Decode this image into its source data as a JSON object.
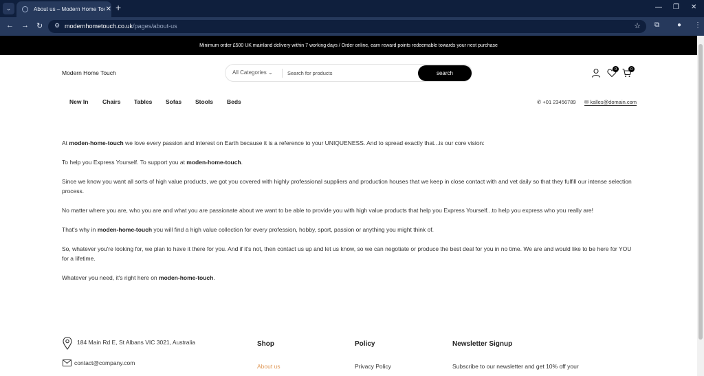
{
  "browser": {
    "tab_title": "About us – Modern Home Touc",
    "url_domain": "modernhometouch.co.uk",
    "url_path": "/pages/about-us"
  },
  "announcement": "Minimum order £500 UK mainland delivery within 7 working days / Order online, earn reward points redeemable towards your next purchase",
  "header": {
    "logo": "Modern Home Touch",
    "category_label": "All Categories",
    "search_placeholder": "Search for products",
    "search_button": "search",
    "wishlist_count": "0",
    "cart_count": "0"
  },
  "nav": {
    "items": [
      "New In",
      "Chairs",
      "Tables",
      "Sofas",
      "Stools",
      "Beds"
    ],
    "phone": "+01 23456789",
    "email": "kalles@domain.com"
  },
  "content": {
    "p1_pre": "At ",
    "brand": "moden-home-touch",
    "p1_post": " we love every passion and interest on Earth because it is a reference to your UNIQUENESS. And to spread exactly that...is our core vision:",
    "p2_pre": "To help you Express Yourself. To support you at ",
    "p2_post": ".",
    "p3": "Since we know you want all sorts of high value products, we got you covered with highly professional suppliers and production houses that we keep in close contact with and vet daily so that they fulfill our intense selection process.",
    "p4": "No matter where you are, who you are and what you are passionate about we want to be able to provide you with high value products that help you Express Yourself...to help you express who you really are!",
    "p5_pre": "That's why in ",
    "p5_post": " you will find a high value collection for every profession, hobby, sport, passion or anything you might think of.",
    "p6": "So, whatever you're looking for, we plan to have it there for you. And if it's not, then contact us up and let us know, so we can negotiate or produce the best deal for you in no time. We are and would like to be here for YOU for a lifetime.",
    "p7_pre": "Whatever you need, it's right here on ",
    "p7_post": "."
  },
  "footer": {
    "address": "184 Main Rd E, St Albans VIC 3021, Australia",
    "email": "contact@company.com",
    "shop_heading": "Shop",
    "shop_link": "About us",
    "policy_heading": "Policy",
    "policy_link": "Privacy Policy",
    "newsletter_heading": "Newsletter Signup",
    "newsletter_text": "Subscribe to our newsletter and get 10% off your"
  },
  "colors": {
    "announcement_bg": "#000000",
    "accent_link": "#e09a5a",
    "browser_bg": "#0f1f3d"
  }
}
